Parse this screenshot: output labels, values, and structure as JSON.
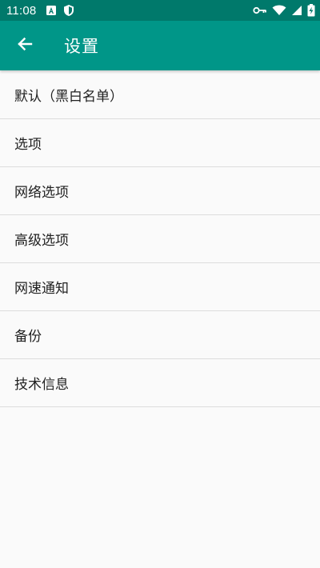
{
  "status_bar": {
    "time": "11:08",
    "left_icons": [
      "a-box-icon",
      "shield-icon"
    ],
    "right_icons": [
      "vpn-key-icon",
      "wifi-icon",
      "signal-icon",
      "battery-charging-icon"
    ]
  },
  "app_bar": {
    "back_icon": "arrow-back-icon",
    "title": "设置",
    "color": "#009688",
    "status_color": "#00796b"
  },
  "menu": {
    "items": [
      {
        "label": "默认（黑白名单）"
      },
      {
        "label": "选项"
      },
      {
        "label": "网络选项"
      },
      {
        "label": "高级选项"
      },
      {
        "label": "网速通知"
      },
      {
        "label": "备份"
      },
      {
        "label": "技术信息"
      }
    ]
  }
}
